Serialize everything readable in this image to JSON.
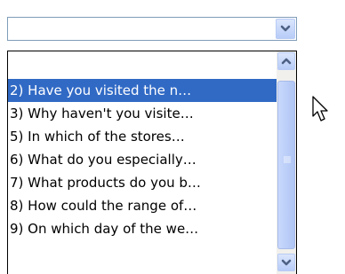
{
  "combo": {
    "value": "",
    "button_icon": "chevron-down-icon"
  },
  "dropdown": {
    "items": [
      {
        "label": ""
      },
      {
        "label": "2) Have you visited the n…",
        "selected": true
      },
      {
        "label": "3) Why haven't you visite…"
      },
      {
        "label": "5) In which of the stores…"
      },
      {
        "label": "6) What do you especially…"
      },
      {
        "label": "7) What products do you b…"
      },
      {
        "label": "8) How could the range of…"
      },
      {
        "label": "9) On which day of the we…"
      }
    ],
    "scrollbar": {
      "up_icon": "chevron-up-icon",
      "down_icon": "chevron-down-icon",
      "thumb_icon": "grip-icon"
    }
  },
  "cursor_icon": "pointer-arrow-icon",
  "colors": {
    "selection": "#316ac5",
    "arrow": "#4d6185",
    "border": "#7f9db9"
  }
}
